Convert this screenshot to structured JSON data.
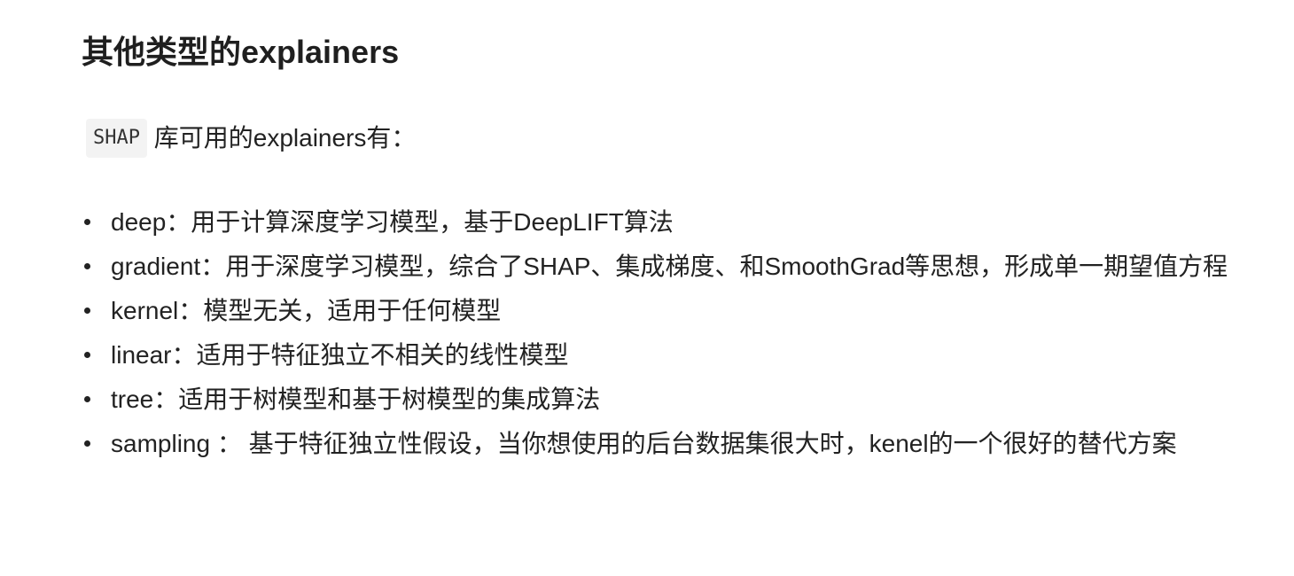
{
  "article": {
    "heading": "其他类型的explainers",
    "intro": {
      "code": "SHAP",
      "text": "库可用的explainers有："
    },
    "items": [
      {
        "term": "deep",
        "desc": "：用于计算深度学习模型，基于DeepLIFT算法"
      },
      {
        "term": "gradient",
        "desc": "：用于深度学习模型，综合了SHAP、集成梯度、和SmoothGrad等思想，形成单一期望值方程"
      },
      {
        "term": "kernel",
        "desc": "：模型无关，适用于任何模型"
      },
      {
        "term": "linear",
        "desc": "：适用于特征独立不相关的线性模型"
      },
      {
        "term": "tree",
        "desc": "：适用于树模型和基于树模型的集成算法"
      },
      {
        "term": "sampling",
        "desc": " ： 基于特征独立性假设，当你想使用的后台数据集很大时，kenel的一个很好的替代方案"
      }
    ]
  }
}
